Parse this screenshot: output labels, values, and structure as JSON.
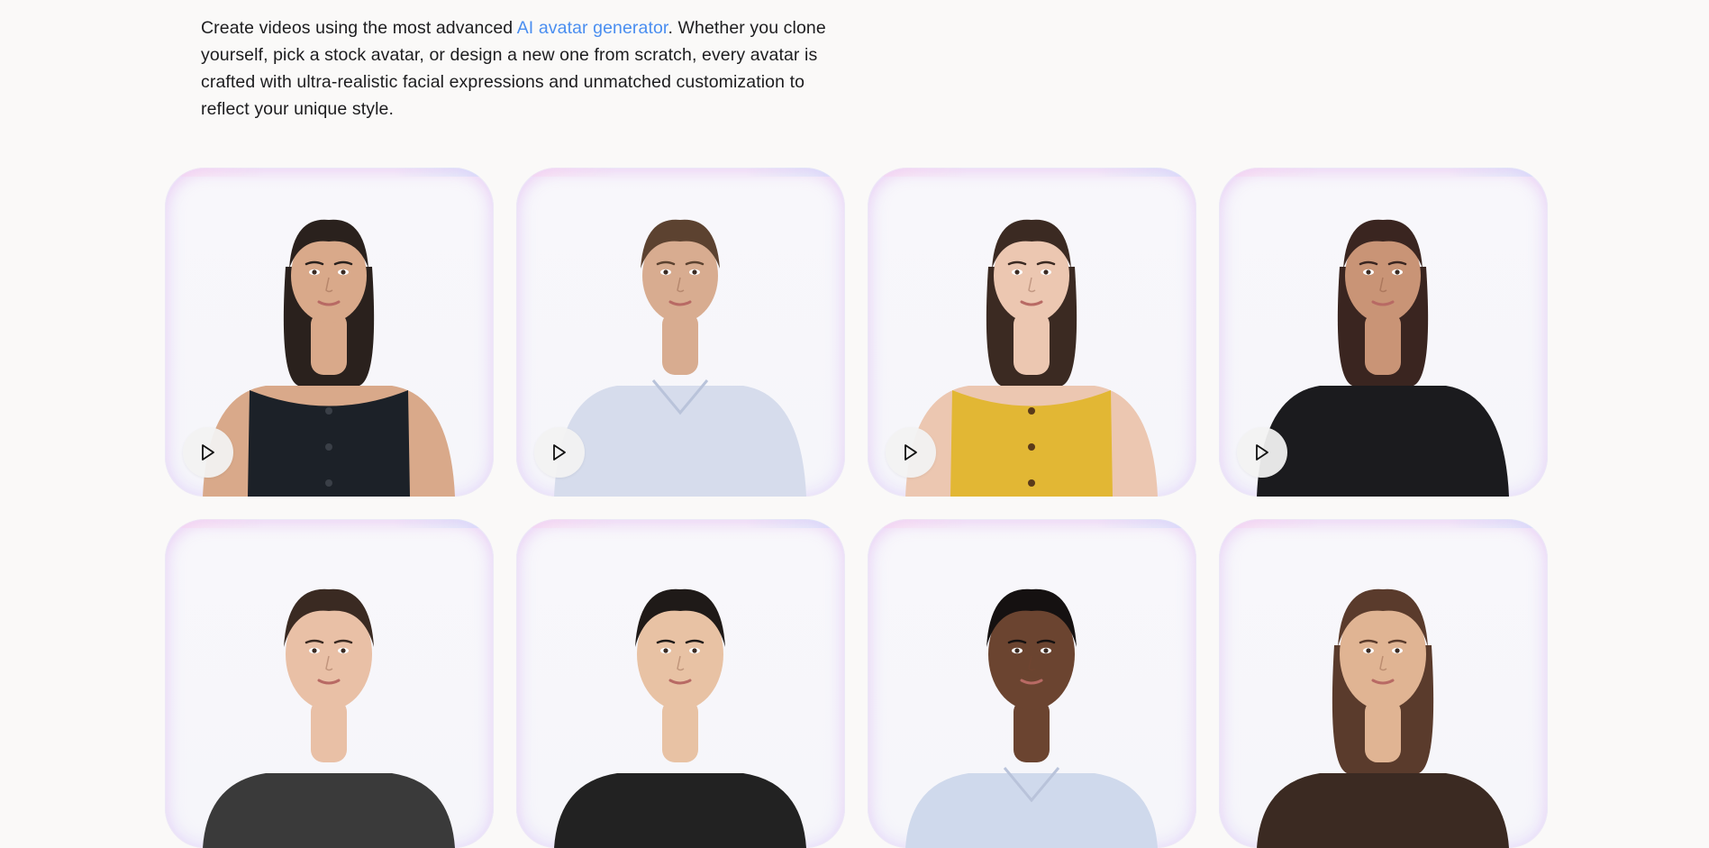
{
  "intro": {
    "text_before": "Create videos using the most advanced ",
    "link_text": "AI avatar generator",
    "text_after": ". Whether you clone yourself, pick a stock avatar, or design a new one from scratch, every avatar is crafted with ultra-realistic facial expressions and unmatched customization to reflect your unique style."
  },
  "colors": {
    "background": "#faf9f8",
    "link": "#4a8ef0",
    "text": "#1d1d1f"
  },
  "avatars": [
    {
      "icon": "play-icon",
      "hair": "#2a211d",
      "skin": "#d9a98a",
      "top": "#1c2128",
      "kind": "woman-sleek-bun"
    },
    {
      "icon": "play-icon",
      "hair": "#5c4230",
      "skin": "#d8ac90",
      "top": "#d6dcec",
      "kind": "man-shirt"
    },
    {
      "icon": "play-icon",
      "hair": "#3b2a22",
      "skin": "#ecc7b1",
      "top": "#e2b734",
      "kind": "woman-yellow"
    },
    {
      "icon": "play-icon",
      "hair": "#3a2520",
      "skin": "#c99476",
      "top": "#1b1b1e",
      "kind": "woman-offshoulder"
    },
    {
      "icon": "play-icon",
      "hair": "#3a2a22",
      "skin": "#e9c0a6",
      "top": "#3a3a3a",
      "kind": "woman-smile"
    },
    {
      "icon": "play-icon",
      "hair": "#1f1a18",
      "skin": "#e8c2a4",
      "top": "#222222",
      "kind": "woman-asian"
    },
    {
      "icon": "play-icon",
      "hair": "#151111",
      "skin": "#6b4430",
      "top": "#cfd9ec",
      "kind": "man-dark"
    },
    {
      "icon": "play-icon",
      "hair": "#5a3b2c",
      "skin": "#e0b493",
      "top": "#3b2a22",
      "kind": "woman-long-hair"
    }
  ]
}
